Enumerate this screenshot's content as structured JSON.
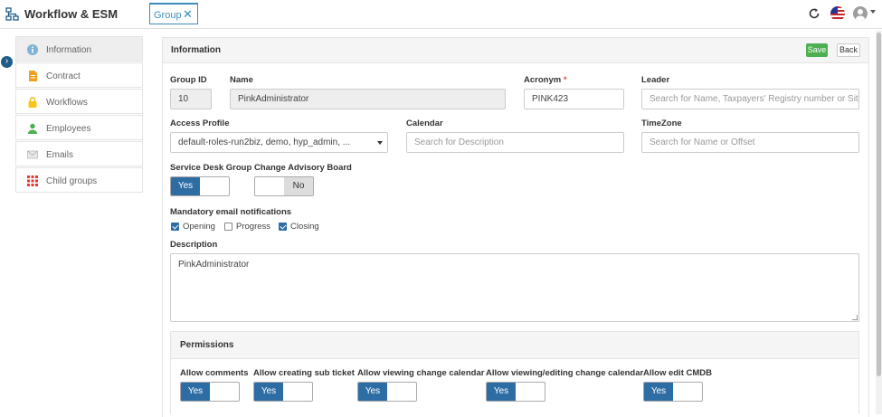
{
  "header": {
    "app_title": "Workflow & ESM",
    "tab_label": "Group",
    "tab_close": "✕",
    "icons": [
      "workflow-icon",
      "refresh-icon",
      "us-flag-icon",
      "avatar",
      "caret-icon"
    ]
  },
  "sidebar": {
    "toggle_glyph": "›",
    "items": [
      {
        "label": "Information",
        "icon": "info-icon",
        "active": true
      },
      {
        "label": "Contract",
        "icon": "document-icon"
      },
      {
        "label": "Workflows",
        "icon": "lock-icon"
      },
      {
        "label": "Employees",
        "icon": "person-icon"
      },
      {
        "label": "Emails",
        "icon": "envelope-icon"
      },
      {
        "label": "Child groups",
        "icon": "grid-icon"
      }
    ]
  },
  "panel": {
    "title": "Information",
    "save_label": "Save",
    "back_label": "Back"
  },
  "form": {
    "group_id_label": "Group ID",
    "group_id_value": "10",
    "name_label": "Name",
    "name_value": "PinkAdministrator",
    "acronym_label": "Acronym",
    "acronym_required": "*",
    "acronym_value": "PINK423",
    "leader_label": "Leader",
    "leader_placeholder": "Search for Name, Taxpayers' Registry number or Situ",
    "access_profile_label": "Access Profile",
    "access_profile_value": "default-roles-run2biz, demo, hyp_admin, ...",
    "calendar_label": "Calendar",
    "calendar_placeholder": "Search for Description",
    "timezone_label": "TimeZone",
    "timezone_placeholder": "Search for Name or Offset",
    "service_desk_label": "Service Desk Group",
    "service_desk_value": "Yes",
    "cab_label": "Change Advisory Board",
    "cab_value": "No",
    "mandatory_label": "Mandatory email notifications",
    "notifications": [
      {
        "label": "Opening",
        "checked": true
      },
      {
        "label": "Progress",
        "checked": false
      },
      {
        "label": "Closing",
        "checked": true
      }
    ],
    "description_label": "Description",
    "description_value": "PinkAdministrator"
  },
  "permissions": {
    "title": "Permissions",
    "items": [
      {
        "label": "Allow comments",
        "value": "Yes"
      },
      {
        "label": "Allow creating sub ticket",
        "value": "Yes"
      },
      {
        "label": "Allow viewing change calendar",
        "value": "Yes"
      },
      {
        "label": "Allow viewing/editing change calendar",
        "value": "Yes"
      },
      {
        "label": "Allow edit CMDB",
        "value": "Yes"
      }
    ]
  },
  "colors": {
    "accent": "#2e6da4",
    "save": "#4caf50",
    "tab": "#3c8dbc"
  }
}
